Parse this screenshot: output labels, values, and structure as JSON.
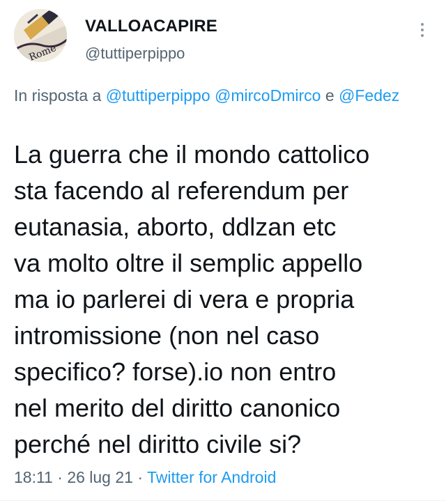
{
  "tweet": {
    "author": {
      "name": "VALLOACAPIRE",
      "handle": "@tuttiperpippo"
    },
    "reply": {
      "prefix": "In risposta a",
      "mention_1": "@tuttiperpippo",
      "mention_2": "@mircoDmirco",
      "conjunction": "e",
      "mention_3": "@Fedez"
    },
    "body_lines": [
      "La guerra che il mondo cattolico",
      "sta facendo al referendum per",
      "eutanasia, aborto, ddlzan etc",
      "va molto oltre il semplic appello",
      "ma io parlerei di vera e propria",
      "intromissione (non nel caso",
      "specifico? forse).io non entro",
      "nel merito del diritto canonico",
      "perché nel diritto civile si?"
    ],
    "meta": {
      "time": "18:11",
      "sep": "·",
      "date": "26 lug 21",
      "source": "Twitter for Android"
    }
  },
  "icons": {
    "more": "more-options-icon"
  },
  "colors": {
    "link": "#1d9bf0",
    "secondary_text": "#536471",
    "primary_text": "#0f1419"
  }
}
